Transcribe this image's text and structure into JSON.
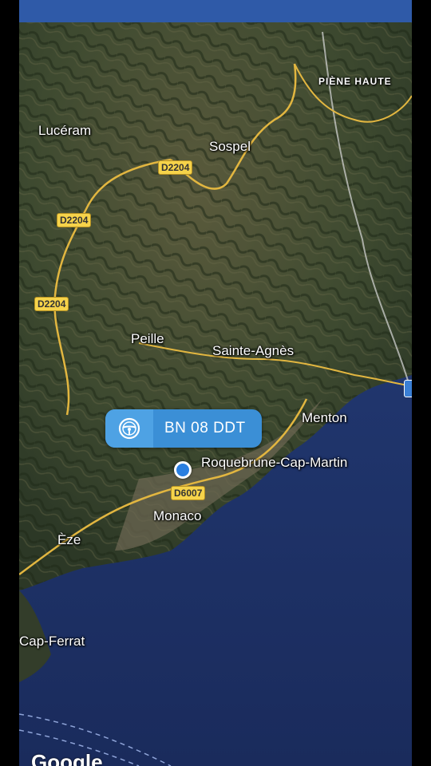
{
  "places": {
    "piene_haute": "PIÈNE HAUTE",
    "luceram": "Lucéram",
    "sospel": "Sospel",
    "peille": "Peille",
    "sainte_agnes": "Sainte-Agnès",
    "menton": "Menton",
    "roquebrune": "Roquebrune-Cap-Martin",
    "monaco": "Monaco",
    "eze": "Èze",
    "cap_ferrat": "Cap-Ferrat"
  },
  "roads": {
    "d2204_a": "D2204",
    "d2204_b": "D2204",
    "d2204_c": "D2204",
    "d6007": "D6007"
  },
  "vehicle": {
    "plate": "BN 08 DDT",
    "icon": "steering-wheel-icon"
  },
  "branding": {
    "logo": "Google"
  },
  "colors": {
    "topbar": "#2f5aa8",
    "bubble": "#3b8fd6",
    "road_sign": "#f6d34a",
    "location_dot": "#2a7fe0"
  }
}
